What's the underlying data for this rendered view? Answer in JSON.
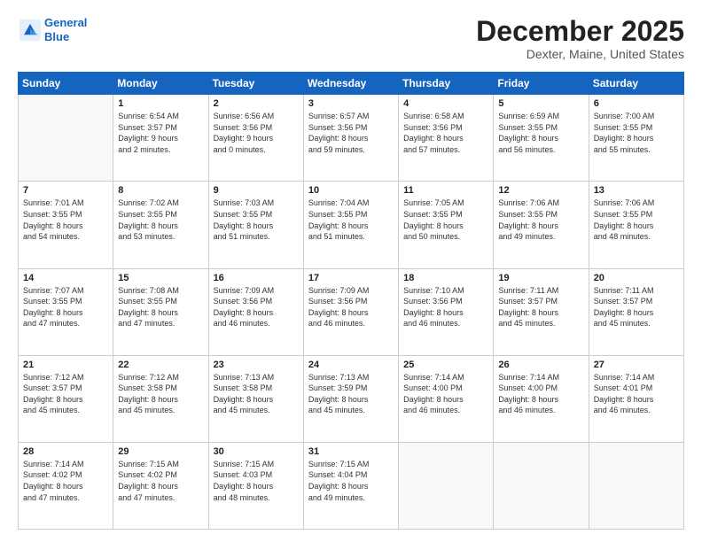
{
  "header": {
    "logo_line1": "General",
    "logo_line2": "Blue",
    "month": "December 2025",
    "location": "Dexter, Maine, United States"
  },
  "days_of_week": [
    "Sunday",
    "Monday",
    "Tuesday",
    "Wednesday",
    "Thursday",
    "Friday",
    "Saturday"
  ],
  "weeks": [
    [
      {
        "day": "",
        "info": ""
      },
      {
        "day": "1",
        "info": "Sunrise: 6:54 AM\nSunset: 3:57 PM\nDaylight: 9 hours\nand 2 minutes."
      },
      {
        "day": "2",
        "info": "Sunrise: 6:56 AM\nSunset: 3:56 PM\nDaylight: 9 hours\nand 0 minutes."
      },
      {
        "day": "3",
        "info": "Sunrise: 6:57 AM\nSunset: 3:56 PM\nDaylight: 8 hours\nand 59 minutes."
      },
      {
        "day": "4",
        "info": "Sunrise: 6:58 AM\nSunset: 3:56 PM\nDaylight: 8 hours\nand 57 minutes."
      },
      {
        "day": "5",
        "info": "Sunrise: 6:59 AM\nSunset: 3:55 PM\nDaylight: 8 hours\nand 56 minutes."
      },
      {
        "day": "6",
        "info": "Sunrise: 7:00 AM\nSunset: 3:55 PM\nDaylight: 8 hours\nand 55 minutes."
      }
    ],
    [
      {
        "day": "7",
        "info": "Sunrise: 7:01 AM\nSunset: 3:55 PM\nDaylight: 8 hours\nand 54 minutes."
      },
      {
        "day": "8",
        "info": "Sunrise: 7:02 AM\nSunset: 3:55 PM\nDaylight: 8 hours\nand 53 minutes."
      },
      {
        "day": "9",
        "info": "Sunrise: 7:03 AM\nSunset: 3:55 PM\nDaylight: 8 hours\nand 51 minutes."
      },
      {
        "day": "10",
        "info": "Sunrise: 7:04 AM\nSunset: 3:55 PM\nDaylight: 8 hours\nand 51 minutes."
      },
      {
        "day": "11",
        "info": "Sunrise: 7:05 AM\nSunset: 3:55 PM\nDaylight: 8 hours\nand 50 minutes."
      },
      {
        "day": "12",
        "info": "Sunrise: 7:06 AM\nSunset: 3:55 PM\nDaylight: 8 hours\nand 49 minutes."
      },
      {
        "day": "13",
        "info": "Sunrise: 7:06 AM\nSunset: 3:55 PM\nDaylight: 8 hours\nand 48 minutes."
      }
    ],
    [
      {
        "day": "14",
        "info": "Sunrise: 7:07 AM\nSunset: 3:55 PM\nDaylight: 8 hours\nand 47 minutes."
      },
      {
        "day": "15",
        "info": "Sunrise: 7:08 AM\nSunset: 3:55 PM\nDaylight: 8 hours\nand 47 minutes."
      },
      {
        "day": "16",
        "info": "Sunrise: 7:09 AM\nSunset: 3:56 PM\nDaylight: 8 hours\nand 46 minutes."
      },
      {
        "day": "17",
        "info": "Sunrise: 7:09 AM\nSunset: 3:56 PM\nDaylight: 8 hours\nand 46 minutes."
      },
      {
        "day": "18",
        "info": "Sunrise: 7:10 AM\nSunset: 3:56 PM\nDaylight: 8 hours\nand 46 minutes."
      },
      {
        "day": "19",
        "info": "Sunrise: 7:11 AM\nSunset: 3:57 PM\nDaylight: 8 hours\nand 45 minutes."
      },
      {
        "day": "20",
        "info": "Sunrise: 7:11 AM\nSunset: 3:57 PM\nDaylight: 8 hours\nand 45 minutes."
      }
    ],
    [
      {
        "day": "21",
        "info": "Sunrise: 7:12 AM\nSunset: 3:57 PM\nDaylight: 8 hours\nand 45 minutes."
      },
      {
        "day": "22",
        "info": "Sunrise: 7:12 AM\nSunset: 3:58 PM\nDaylight: 8 hours\nand 45 minutes."
      },
      {
        "day": "23",
        "info": "Sunrise: 7:13 AM\nSunset: 3:58 PM\nDaylight: 8 hours\nand 45 minutes."
      },
      {
        "day": "24",
        "info": "Sunrise: 7:13 AM\nSunset: 3:59 PM\nDaylight: 8 hours\nand 45 minutes."
      },
      {
        "day": "25",
        "info": "Sunrise: 7:14 AM\nSunset: 4:00 PM\nDaylight: 8 hours\nand 46 minutes."
      },
      {
        "day": "26",
        "info": "Sunrise: 7:14 AM\nSunset: 4:00 PM\nDaylight: 8 hours\nand 46 minutes."
      },
      {
        "day": "27",
        "info": "Sunrise: 7:14 AM\nSunset: 4:01 PM\nDaylight: 8 hours\nand 46 minutes."
      }
    ],
    [
      {
        "day": "28",
        "info": "Sunrise: 7:14 AM\nSunset: 4:02 PM\nDaylight: 8 hours\nand 47 minutes."
      },
      {
        "day": "29",
        "info": "Sunrise: 7:15 AM\nSunset: 4:02 PM\nDaylight: 8 hours\nand 47 minutes."
      },
      {
        "day": "30",
        "info": "Sunrise: 7:15 AM\nSunset: 4:03 PM\nDaylight: 8 hours\nand 48 minutes."
      },
      {
        "day": "31",
        "info": "Sunrise: 7:15 AM\nSunset: 4:04 PM\nDaylight: 8 hours\nand 49 minutes."
      },
      {
        "day": "",
        "info": ""
      },
      {
        "day": "",
        "info": ""
      },
      {
        "day": "",
        "info": ""
      }
    ]
  ]
}
